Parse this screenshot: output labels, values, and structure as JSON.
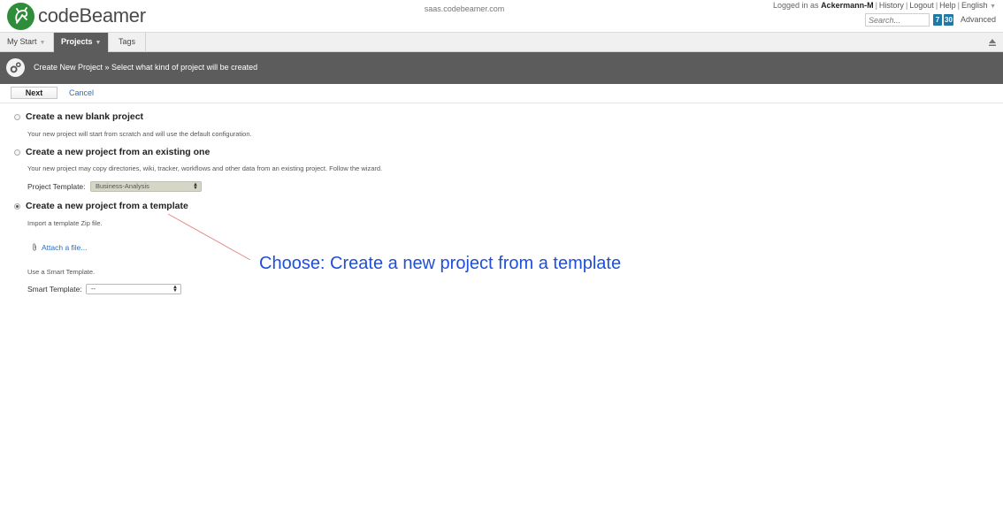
{
  "header": {
    "logo_text": "codeBeamer",
    "site_url": "saas.codebeamer.com",
    "logged_in_prefix": "Logged in as",
    "username": "Ackermann-M",
    "menu": [
      "History",
      "Logout",
      "Help",
      "English"
    ],
    "search_placeholder": "Search...",
    "badge_1": "7",
    "badge_2": "30",
    "advanced_label": "Advanced"
  },
  "tabs": [
    {
      "label": "My Start",
      "active": false
    },
    {
      "label": "Projects",
      "active": true
    },
    {
      "label": "Tags",
      "active": false
    }
  ],
  "titlebar": {
    "text": "Create New Project » Select what kind of project will be created"
  },
  "actions": {
    "next_label": "Next",
    "cancel_label": "Cancel"
  },
  "options": {
    "blank": {
      "title": "Create a new blank project",
      "description": "Your new project will start from scratch and will use the default configuration.",
      "selected": false
    },
    "existing": {
      "title": "Create a new project from an existing one",
      "description": "Your new project may copy directories, wiki, tracker, workflows and other data from an existing project. Follow the wizard.",
      "template_label": "Project Template:",
      "template_value": "Business-Analysis",
      "selected": false
    },
    "template": {
      "title": "Create a new project from a template",
      "description": "Import a template Zip file.",
      "attach_label": "Attach a file...",
      "smart_desc": "Use a Smart Template.",
      "smart_label": "Smart Template:",
      "smart_value": "--",
      "selected": true
    }
  },
  "annotation": {
    "text": "Choose: Create a new project from a template",
    "color": "#1f4fd8",
    "line_color": "#e58a8a"
  },
  "colors": {
    "accent": "#2f8d3a",
    "dark_bar": "#5c5c5c",
    "link": "#2a6ebb",
    "badge": "#1f79a7"
  }
}
